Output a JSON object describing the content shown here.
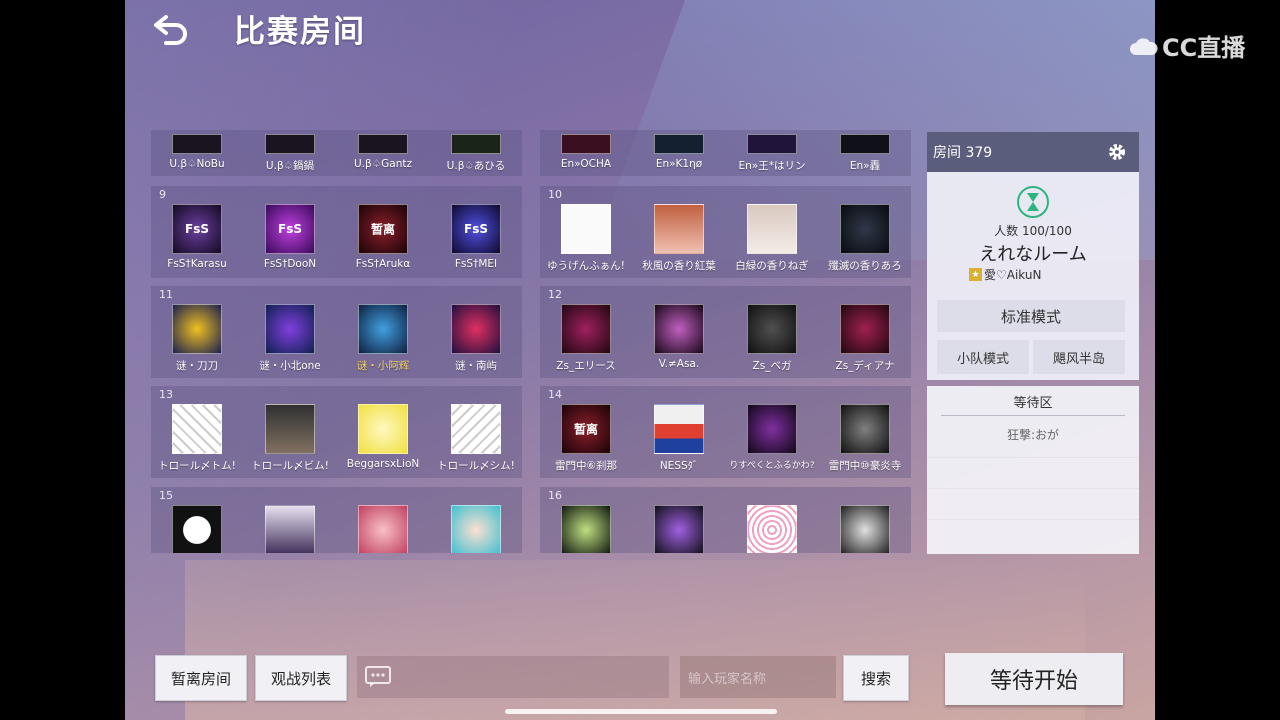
{
  "header": {
    "title": "比赛房间",
    "back_icon": "back-arrow-icon",
    "watermark": "CC直播"
  },
  "groups": [
    {
      "num": "",
      "players": [
        "U.β♤NoBu",
        "U.β♤鍋鍋",
        "U.β♤Gantz",
        "U.β♤あひる"
      ]
    },
    {
      "num": "",
      "players": [
        "En»OCHA",
        "En»K1ηø",
        "En»王*はリン",
        "En»轟"
      ]
    },
    {
      "num": "9",
      "players": [
        "FsS†Karasu",
        "FsS†DooN",
        "FsS†Arukα",
        "FsS†MEI"
      ]
    },
    {
      "num": "10",
      "players": [
        "ゆうげんふぁん!",
        "秋風の香り紅葉",
        "白緑の香りねぎ",
        "殲滅の香りあろ"
      ]
    },
    {
      "num": "11",
      "players": [
        "谜・刀刀",
        "谜・小北one",
        "谜・小阿辉",
        "谜・南屿"
      ]
    },
    {
      "num": "12",
      "players": [
        "Zs_エリース",
        "V.≠Asa.",
        "Zs_ベガ",
        "Zs_ディアナ"
      ]
    },
    {
      "num": "13",
      "players": [
        "トロール〆トム!",
        "トロール〆ビム!",
        "BeggarsxLioN",
        "トロール〆シム!"
      ]
    },
    {
      "num": "14",
      "players": [
        "雷門中⑥刹那",
        "NESSﾀﾞ",
        "りすぺくとふるかわ?",
        "雷門中⑩豪炎寺"
      ]
    },
    {
      "num": "15",
      "players": [
        "",
        "",
        "",
        ""
      ]
    },
    {
      "num": "16",
      "players": [
        "",
        "",
        "",
        ""
      ]
    }
  ],
  "avatar_text": {
    "zanli": "暂离",
    "fss": "FsS"
  },
  "room": {
    "label": "房间 379",
    "count": "人数 100/100",
    "name": "えれなルーム",
    "owner": "愛♡AikuN",
    "mode_main": "标准模式",
    "mode_team": "小队模式",
    "mode_island": "飓风半岛"
  },
  "waiting": {
    "title": "等待区",
    "players": [
      "狂撃:おが"
    ]
  },
  "bottom": {
    "away_label": "暂离房间",
    "spectate_label": "观战列表",
    "search_placeholder": "输入玩家名称",
    "search_label": "搜索",
    "start_label": "等待开始"
  },
  "colors": {
    "accent_green": "#2cb67d",
    "header_bar": "#5b5d7c",
    "highlight_name": "#f2d46b"
  }
}
